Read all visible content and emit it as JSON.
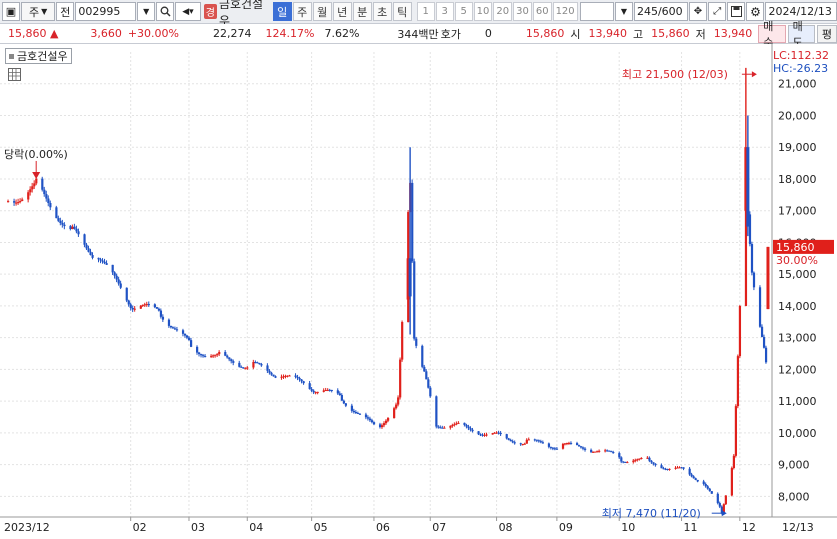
{
  "toolbar": {
    "stock_type": "주",
    "jeon_label": "전",
    "code": "002995",
    "gyeong_badge": "경",
    "name": "금호건설우",
    "periods": [
      "일",
      "주",
      "월",
      "년",
      "분",
      "초",
      "틱"
    ],
    "active_period": "일",
    "tick_numbers": [
      "1",
      "3",
      "5",
      "10",
      "20",
      "30",
      "60",
      "120"
    ],
    "count_display": "245/600",
    "date": "2024/12/13"
  },
  "quote": {
    "price": "15,860",
    "change": "3,660",
    "change_pct": "+30.00%",
    "volume": "22,274",
    "volume_ratio": "124.17%",
    "turnover": "7.62%",
    "amount": "344백만",
    "hoga_label": "호가",
    "hoga_value": "0",
    "bid_price": "15,860",
    "open_label": "시",
    "open": "13,940",
    "high_label": "고",
    "high": "15,860",
    "low_label": "저",
    "low": "13,940",
    "buy_label": "매수",
    "sell_label": "매도",
    "eval_label": "평"
  },
  "chart_legend": "금호건설우",
  "chart_data": {
    "type": "candlestick",
    "title": "금호건설우",
    "ylim": [
      7350,
      22000
    ],
    "y_ticks": [
      8000,
      9000,
      10000,
      11000,
      12000,
      13000,
      14000,
      15000,
      16000,
      17000,
      18000,
      19000,
      20000,
      21000
    ],
    "y_tick_labels": [
      "8,000",
      "9,000",
      "10,000",
      "11,000",
      "12,000",
      "13,000",
      "14,000",
      "15,000",
      "16,000",
      "17,000",
      "18,000",
      "19,000",
      "20,000",
      "21,000"
    ],
    "x_ticks": [
      "2023/12",
      "02",
      "03",
      "04",
      "05",
      "06",
      "07",
      "08",
      "09",
      "10",
      "11",
      "12",
      "12/13"
    ],
    "lc_label": "LC:112.32",
    "hc_label": "HC:-26.23",
    "current_price_label": "15,860",
    "current_pct_label": "30.00%",
    "annotations": {
      "high": "최고 21,500 (12/03)",
      "low": "최저 7,470 (11/20)",
      "limit_down": "당락(0.00%)"
    },
    "series": [
      {
        "x": "2023-12-01",
        "close": 17300
      },
      {
        "x": "2023-12-15",
        "close": 17800
      },
      {
        "x": "2024-01-02",
        "close": 16300
      },
      {
        "x": "2024-01-15",
        "close": 15500
      },
      {
        "x": "2024-02-01",
        "close": 14000
      },
      {
        "x": "2024-02-15",
        "close": 13800
      },
      {
        "x": "2024-03-01",
        "close": 12700
      },
      {
        "x": "2024-03-15",
        "close": 12400
      },
      {
        "x": "2024-04-01",
        "close": 12100
      },
      {
        "x": "2024-04-15",
        "close": 11800
      },
      {
        "x": "2024-05-01",
        "close": 11400
      },
      {
        "x": "2024-05-15",
        "close": 11100
      },
      {
        "x": "2024-06-01",
        "close": 10100
      },
      {
        "x": "2024-06-12",
        "close": 11000
      },
      {
        "x": "2024-06-18",
        "close": 18000
      },
      {
        "x": "2024-06-20",
        "close": 13100
      },
      {
        "x": "2024-06-25",
        "close": 11800
      },
      {
        "x": "2024-07-01",
        "close": 10300
      },
      {
        "x": "2024-07-15",
        "close": 10200
      },
      {
        "x": "2024-08-01",
        "close": 9900
      },
      {
        "x": "2024-08-15",
        "close": 9700
      },
      {
        "x": "2024-09-01",
        "close": 9600
      },
      {
        "x": "2024-09-15",
        "close": 9500
      },
      {
        "x": "2024-10-01",
        "close": 9200
      },
      {
        "x": "2024-10-15",
        "close": 9100
      },
      {
        "x": "2024-11-01",
        "close": 8800
      },
      {
        "x": "2024-11-10",
        "close": 8500
      },
      {
        "x": "2024-11-20",
        "close": 7500
      },
      {
        "x": "2024-11-26",
        "close": 9300
      },
      {
        "x": "2024-12-02",
        "close": 18500
      },
      {
        "x": "2024-12-03",
        "close": 17000
      },
      {
        "x": "2024-12-05",
        "close": 15200
      },
      {
        "x": "2024-12-09",
        "close": 13200
      },
      {
        "x": "2024-12-12",
        "close": 12200
      },
      {
        "x": "2024-12-13",
        "close": 15860
      }
    ]
  }
}
